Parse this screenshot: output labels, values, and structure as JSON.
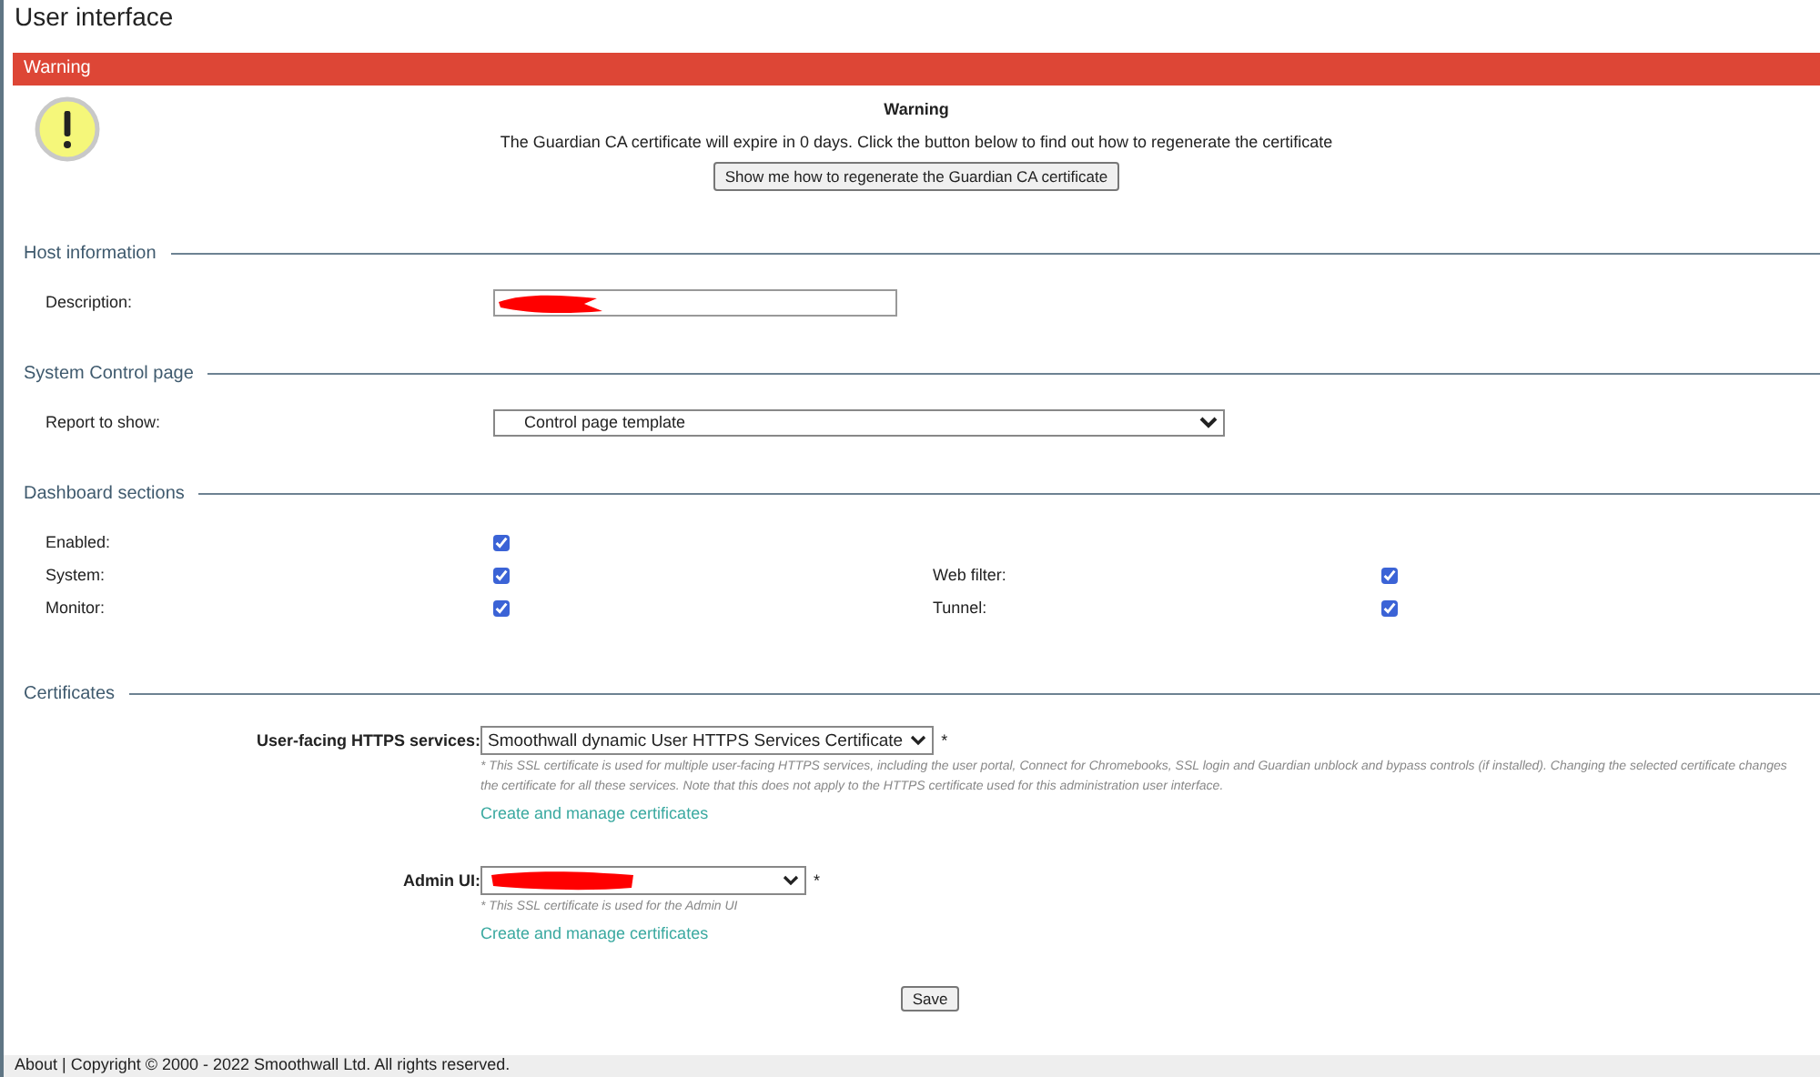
{
  "page_title": "User interface",
  "warning": {
    "header": "Warning",
    "title": "Warning",
    "message": "The Guardian CA certificate will expire in 0 days. Click the button below to find out how to regenerate the certificate",
    "button": "Show me how to regenerate the Guardian CA certificate"
  },
  "host_information": {
    "legend": "Host information",
    "description": {
      "label": "Description:",
      "redacted": true
    }
  },
  "system_control_page": {
    "legend": "System Control page",
    "report": {
      "label": "Report to show:",
      "value": "Control page template"
    }
  },
  "dashboard_sections": {
    "legend": "Dashboard sections",
    "rows": [
      {
        "items": [
          {
            "label": "Enabled:",
            "checked": true
          }
        ]
      },
      {
        "items": [
          {
            "label": "System:",
            "checked": true
          },
          {
            "label": "Web filter:",
            "checked": true
          }
        ]
      },
      {
        "items": [
          {
            "label": "Monitor:",
            "checked": true
          },
          {
            "label": "Tunnel:",
            "checked": true
          }
        ]
      }
    ]
  },
  "certificates": {
    "legend": "Certificates",
    "fields": [
      {
        "label": "User-facing HTTPS services:",
        "value": "Smoothwall dynamic User HTTPS Services Certificate",
        "redacted": false,
        "required": "*",
        "note": "* This SSL certificate is used for multiple user-facing HTTPS services, including the user portal, Connect for Chromebooks, SSL login and Guardian unblock and bypass controls (if installed). Changing the selected certificate changes the certificate for all these services. Note that this does not apply to the HTTPS certificate used for this administration user interface.",
        "link": "Create and manage certificates"
      },
      {
        "label": "Admin UI:",
        "redacted": true,
        "required": "*",
        "note": "* This SSL certificate is used for the Admin UI",
        "link": "Create and manage certificates"
      }
    ]
  },
  "save_button": "Save",
  "footer": "About | Copyright © 2000 - 2022 Smoothwall Ltd. All rights reserved."
}
